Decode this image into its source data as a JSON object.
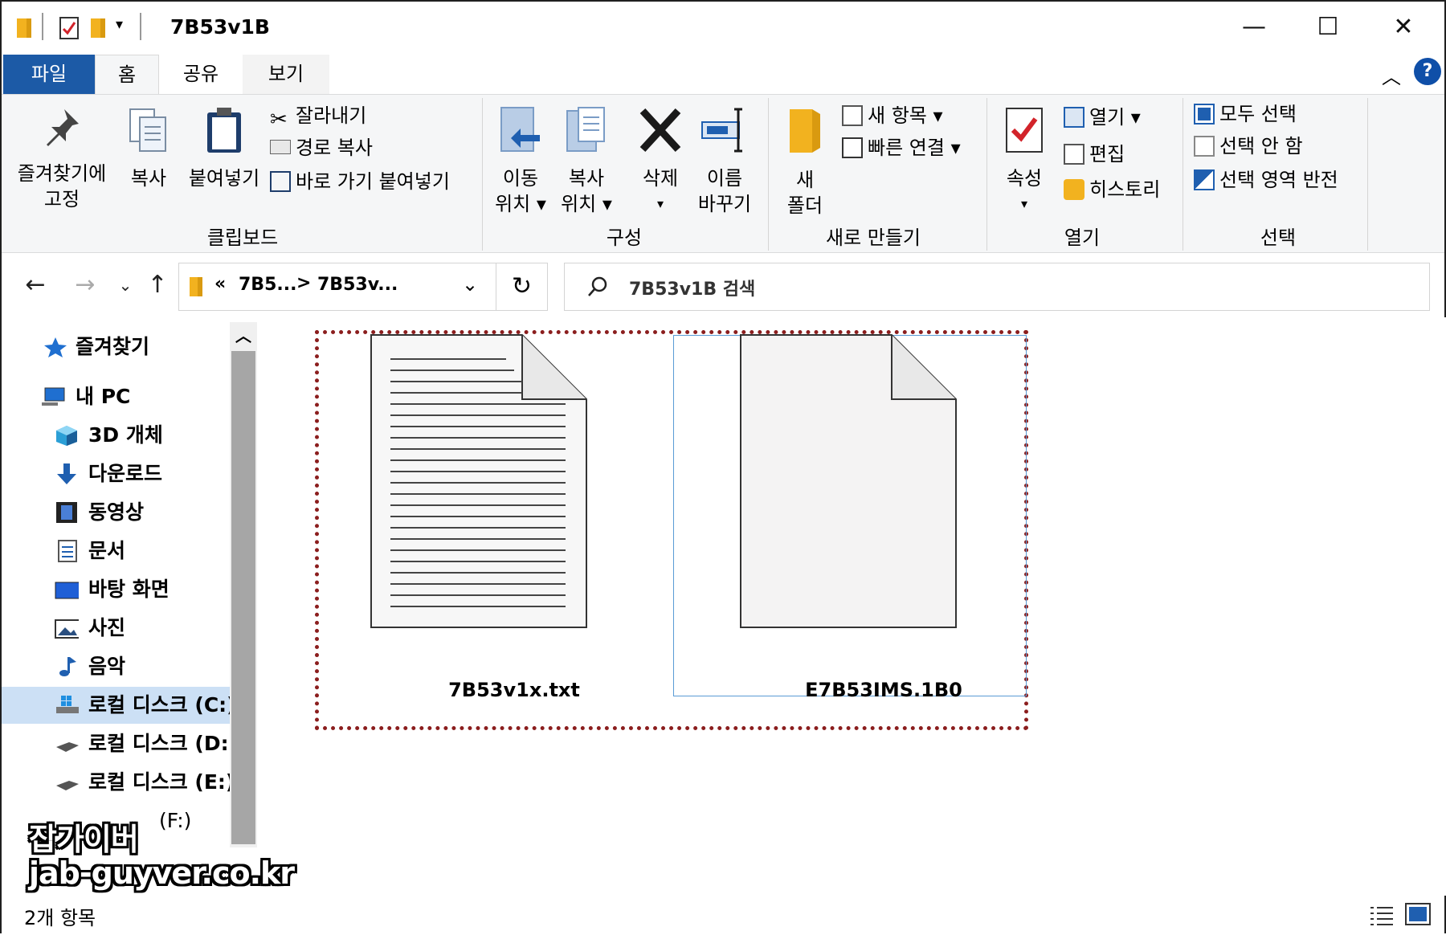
{
  "window": {
    "title": "7B53v1B",
    "minimize_glyph": "—",
    "maximize_glyph": "☐",
    "close_glyph": "✕"
  },
  "tabs": [
    {
      "label": "파일",
      "active": false
    },
    {
      "label": "홈",
      "active": true
    },
    {
      "label": "공유",
      "active": false
    },
    {
      "label": "보기",
      "active": false
    }
  ],
  "ribbon": {
    "clipboard": {
      "group_label": "클립보드",
      "pin_label_1": "즐겨찾기에",
      "pin_label_2": "고정",
      "copy_label": "복사",
      "paste_label": "붙여넣기",
      "cut_label": "잘라내기",
      "copy_path_label": "경로 복사",
      "paste_shortcut_label": "바로 가기 붙여넣기"
    },
    "organize": {
      "group_label": "구성",
      "move_label_1": "이동",
      "move_label_2": "위치 ▾",
      "copyto_label_1": "복사",
      "copyto_label_2": "위치 ▾",
      "delete_label": "삭제",
      "delete_arrow": "▾",
      "rename_label_1": "이름",
      "rename_label_2": "바꾸기"
    },
    "new": {
      "group_label": "새로 만들기",
      "new_folder_label_1": "새",
      "new_folder_label_2": "폴더",
      "new_item_label": "새 항목 ▾",
      "easy_access_label": "빠른 연결 ▾"
    },
    "open": {
      "group_label": "열기",
      "properties_label": "속성",
      "properties_arrow": "▾",
      "open_label": "열기 ▾",
      "edit_label": "편집",
      "history_label": "히스토리"
    },
    "select": {
      "group_label": "선택",
      "select_all_label": "모두 선택",
      "select_none_label": "선택 안 함",
      "invert_label": "선택 영역 반전"
    }
  },
  "address": {
    "crumb_prefix": "«",
    "crumb_1": "7B5...",
    "crumb_sep": ">",
    "crumb_2": "7B53v...",
    "search_placeholder": "7B53v1B 검색"
  },
  "nav": {
    "items": [
      {
        "label": "즐겨찾기",
        "icon": "star-icon"
      },
      {
        "label": "내 PC",
        "icon": "pc-icon"
      },
      {
        "label": "3D 개체",
        "icon": "cube-icon"
      },
      {
        "label": "다운로드",
        "icon": "download-icon"
      },
      {
        "label": "동영상",
        "icon": "video-icon"
      },
      {
        "label": "문서",
        "icon": "document-icon"
      },
      {
        "label": "바탕 화면",
        "icon": "desktop-icon"
      },
      {
        "label": "사진",
        "icon": "picture-icon"
      },
      {
        "label": "음악",
        "icon": "music-icon"
      },
      {
        "label": "로컬 디스크 (C:)",
        "icon": "windows-drive-icon"
      },
      {
        "label": "로컬 디스크 (D:)",
        "icon": "drive-icon"
      },
      {
        "label": "로컬 디스크 (E:)",
        "icon": "drive-icon"
      },
      {
        "label": "(F:)",
        "icon": "drive-icon"
      }
    ]
  },
  "files": [
    {
      "name": "7B53v1x.txt",
      "type": "text-file-icon",
      "selected": false
    },
    {
      "name": "E7B53IMS.1B0",
      "type": "blank-file-icon",
      "selected": true
    }
  ],
  "status": {
    "item_count": "2개 항목"
  },
  "watermark": {
    "line1": "잡가이버",
    "line2": "jab-guyver.co.kr"
  },
  "colors": {
    "file_tab": "#1c5aa6",
    "selection_border": "#5a9bd5",
    "highlight_dotted": "#8b1e1e",
    "folder": "#f2b21f",
    "nav_selected": "#cce0f5"
  }
}
